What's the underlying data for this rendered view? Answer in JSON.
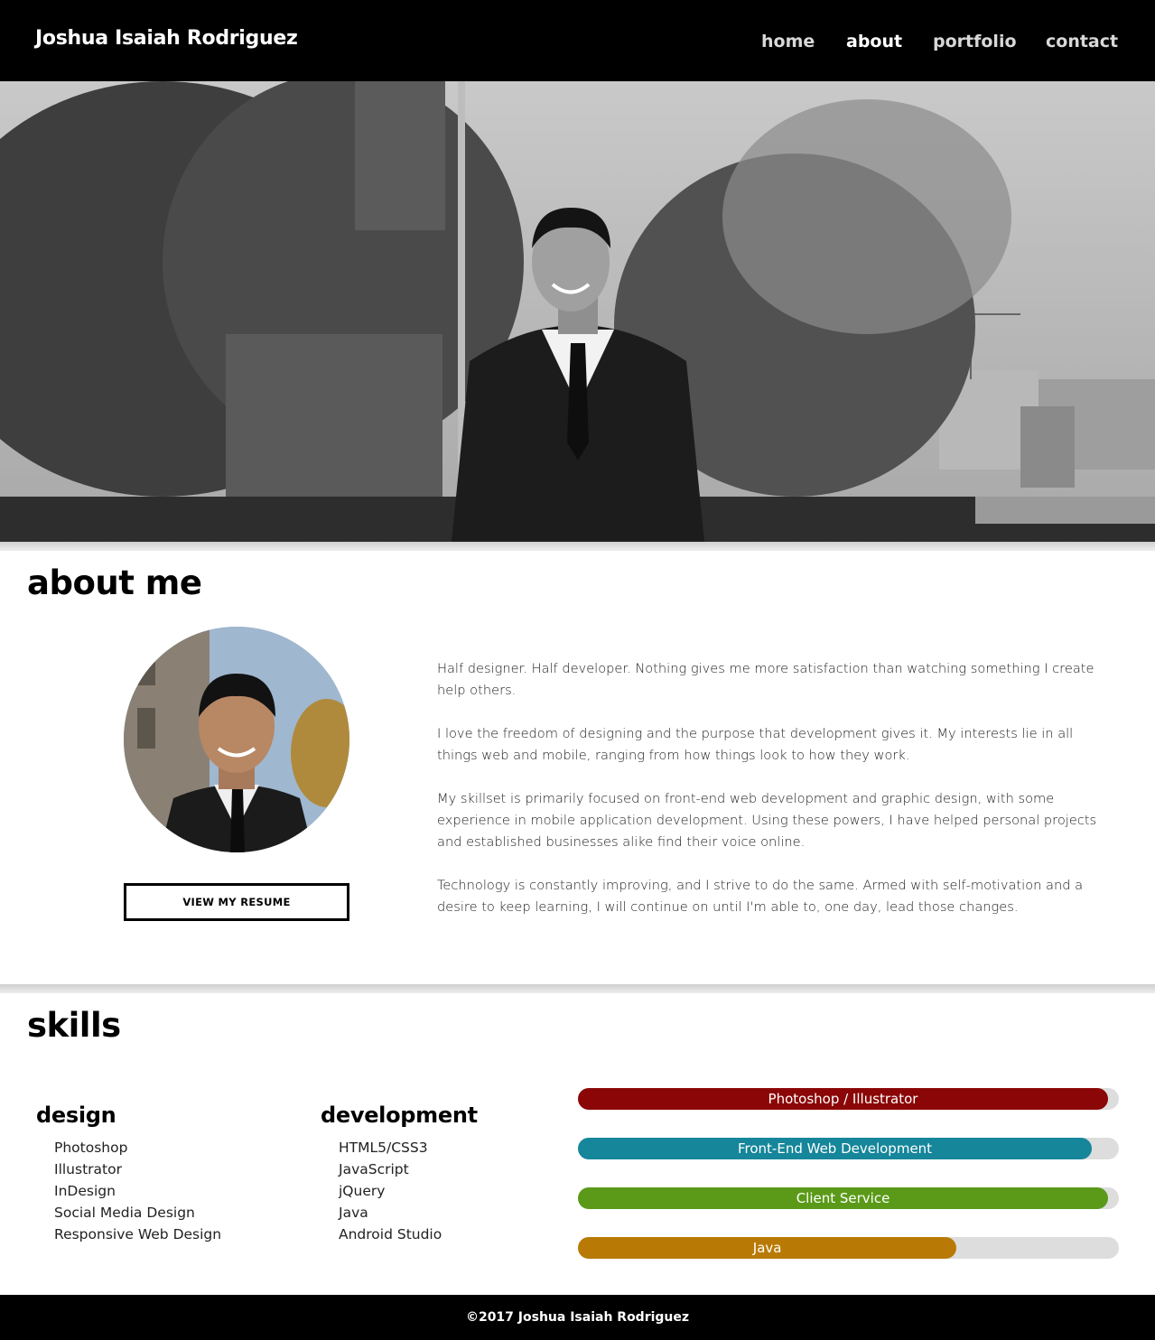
{
  "header": {
    "brand": "Joshua Isaiah Rodriguez",
    "nav": [
      {
        "label": "home",
        "active": false
      },
      {
        "label": "about",
        "active": true
      },
      {
        "label": "portfolio",
        "active": false
      },
      {
        "label": "contact",
        "active": false
      }
    ]
  },
  "about": {
    "title": "about me",
    "resume_button": "VIEW MY RESUME",
    "paragraphs": [
      "Half designer. Half developer. Nothing gives me more satisfaction than watching something I create help others.",
      "I love the freedom of designing and the purpose that development gives it. My interests lie in all things web and mobile, ranging from how things look to how they work.",
      "My skillset is primarily focused on front-end web development and graphic design, with some experience in mobile application development. Using these powers, I have helped personal projects and established businesses alike find their voice online.",
      "Technology is constantly improving, and I strive to do the same. Armed with self-motivation and a desire to keep learning, I will continue on until I'm able to, one day, lead those changes."
    ]
  },
  "skills": {
    "title": "skills",
    "design": {
      "heading": "design",
      "items": [
        "Photoshop",
        "Illustrator",
        "InDesign",
        "Social Media Design",
        "Responsive Web Design"
      ]
    },
    "development": {
      "heading": "development",
      "items": [
        "HTML5/CSS3",
        "JavaScript",
        "jQuery",
        "Java",
        "Android Studio"
      ]
    },
    "bars": [
      {
        "label": "Photoshop / Illustrator",
        "percent": 98,
        "color": "#8b0707"
      },
      {
        "label": "Front-End Web Development",
        "percent": 95,
        "color": "#16869a"
      },
      {
        "label": "Client Service",
        "percent": 98,
        "color": "#5a9a18"
      },
      {
        "label": "Java",
        "percent": 70,
        "color": "#b87a04"
      }
    ]
  },
  "footer": {
    "text": "©2017 Joshua Isaiah Rodriguez"
  }
}
